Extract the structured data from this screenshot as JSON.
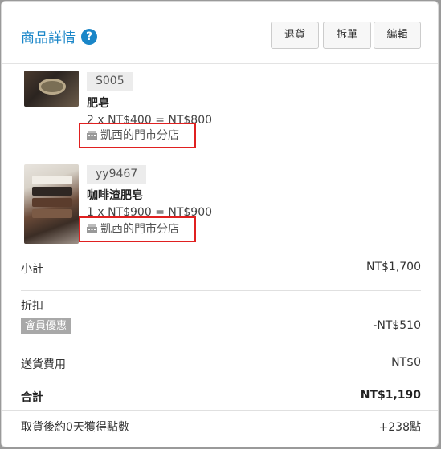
{
  "header": {
    "title": "商品詳情",
    "help_glyph": "?",
    "buttons": {
      "return": "退貨",
      "split": "拆單",
      "edit": "編輯"
    }
  },
  "items": [
    {
      "sku": "S005",
      "name": "肥皂",
      "calc": "2 x NT$400 = NT$800",
      "store": "凱西的門市分店",
      "thumb_icon": "soap-dish-image"
    },
    {
      "sku": "yy9467",
      "name": "咖啡渣肥皂",
      "calc": "1 x NT$900 = NT$900",
      "store": "凱西的門市分店",
      "thumb_icon": "soap-bars-image"
    }
  ],
  "summary": {
    "subtotal_label": "小計",
    "subtotal_value": "NT$1,700",
    "discount_label": "折扣",
    "member_badge": "會員優惠",
    "discount_value": "-NT$510",
    "shipping_label": "送貨費用",
    "shipping_value": "NT$0",
    "total_label": "合計",
    "total_value": "NT$1,190",
    "points_label": "取貨後約0天獲得點數",
    "points_value": "+238點"
  },
  "colors": {
    "accent": "#1a86c8",
    "highlight_border": "#e02020"
  },
  "icons": {
    "help": "help-circle-icon",
    "store": "store-icon"
  }
}
